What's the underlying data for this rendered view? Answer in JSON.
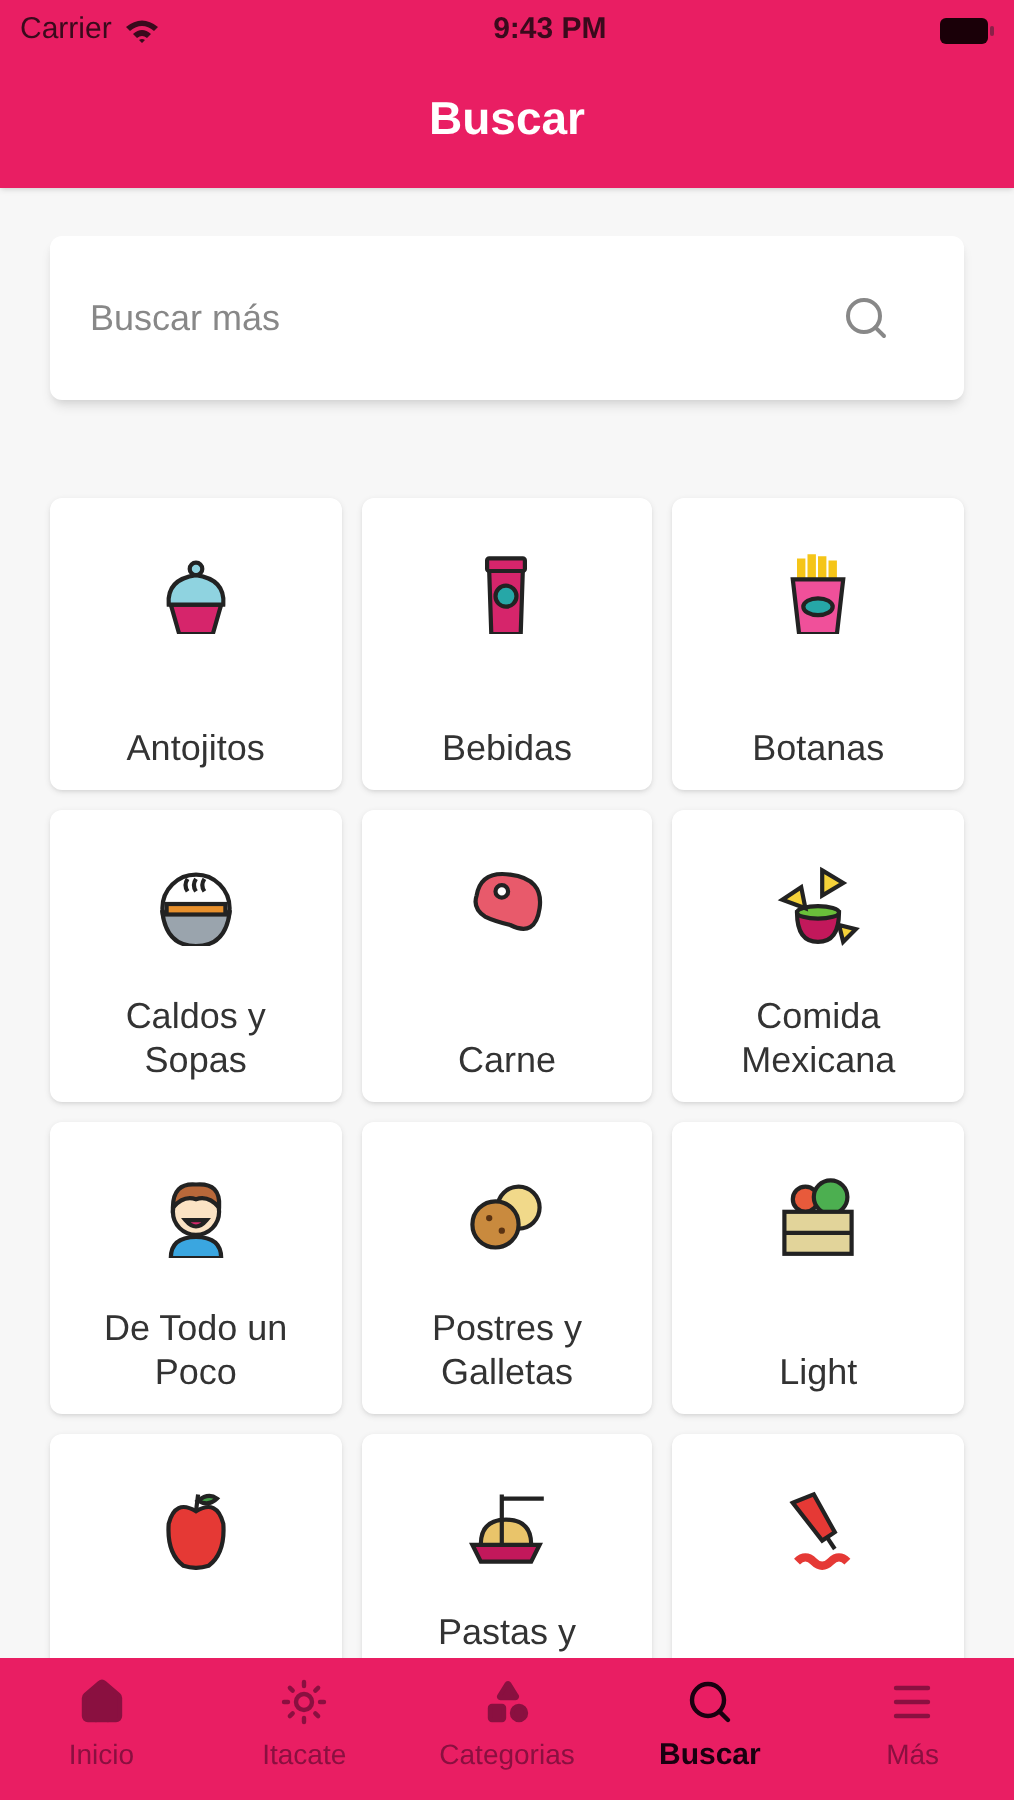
{
  "status_bar": {
    "carrier": "Carrier",
    "time": "9:43 PM"
  },
  "header": {
    "title": "Buscar"
  },
  "search": {
    "placeholder": "Buscar más"
  },
  "categories": [
    {
      "kind": "labeled",
      "label": "Antojitos"
    },
    {
      "kind": "labeled",
      "label": "Bebidas"
    },
    {
      "kind": "labeled",
      "label": "Botanas"
    },
    {
      "kind": "labeled",
      "label": "Caldos y Sopas"
    },
    {
      "kind": "labeled",
      "label": "Carne"
    },
    {
      "kind": "labeled",
      "label": "Comida Mexicana"
    },
    {
      "kind": "labeled",
      "label": "De Todo un Poco"
    },
    {
      "kind": "labeled",
      "label": "Postres y Galletas"
    },
    {
      "kind": "labeled",
      "label": "Light"
    },
    {
      "kind": "icon_only"
    },
    {
      "kind": "cut_label",
      "label": "Pastas y"
    },
    {
      "kind": "icon_only"
    }
  ],
  "tab_bar": [
    {
      "label": "Inicio",
      "selected": false
    },
    {
      "label": "Itacate",
      "selected": false
    },
    {
      "label": "Categorias",
      "selected": false
    },
    {
      "label": "Buscar",
      "selected": true
    },
    {
      "label": "Más",
      "selected": false
    }
  ]
}
